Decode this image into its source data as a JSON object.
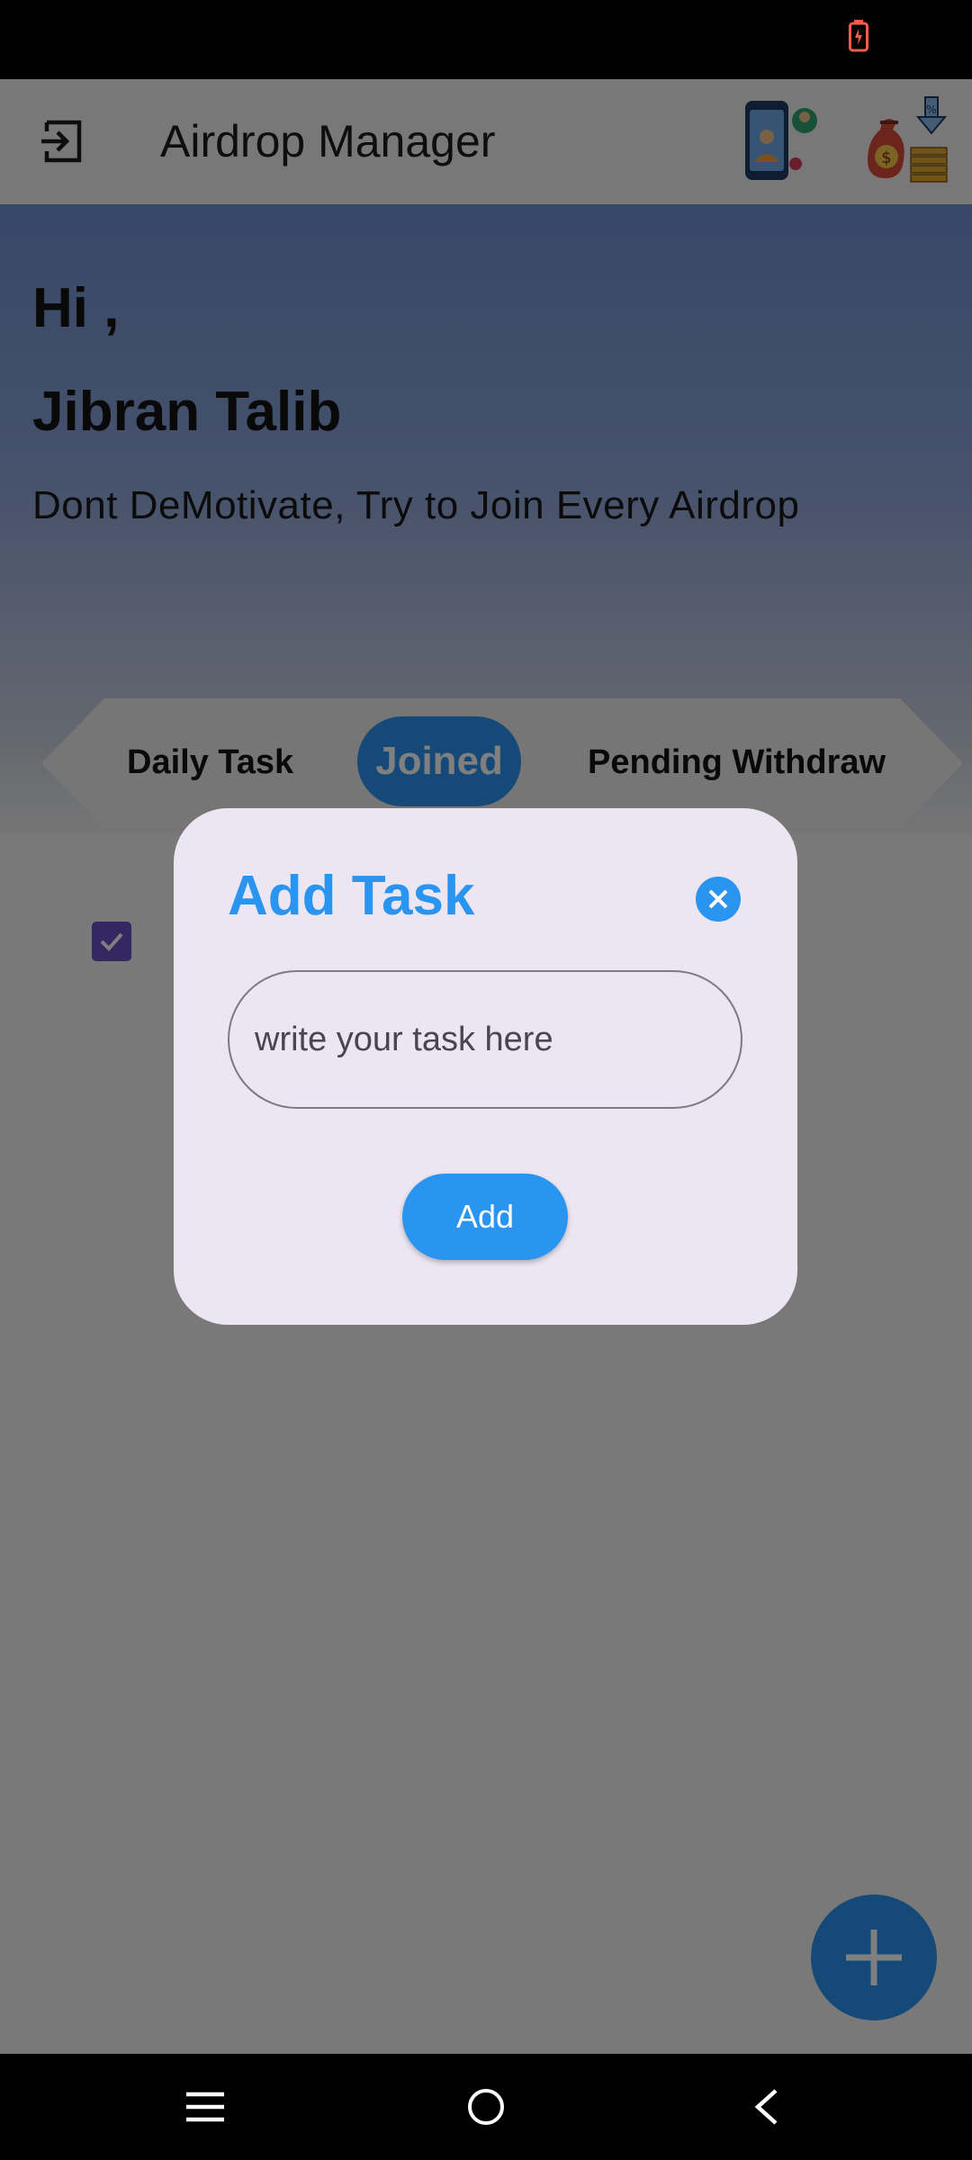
{
  "status_bar": {
    "battery": "battery-charging-icon"
  },
  "app_bar": {
    "title": "Airdrop Manager",
    "logout_icon": "logout-icon",
    "icons": [
      "phone-users-icon",
      "money-bag-icon"
    ]
  },
  "hero": {
    "greeting": "Hi ,",
    "user_name": "Jibran Talib",
    "motivation": "Dont DeMotivate, Try to Join Every Airdrop"
  },
  "tabs": {
    "items": [
      "Daily Task",
      "Joined",
      "Pending Withdraw"
    ],
    "selected": "Joined"
  },
  "dialog": {
    "title": "Add Task",
    "input_placeholder": "write your task here",
    "input_value": "",
    "add_label": "Add"
  },
  "colors": {
    "accent": "#2a95f0",
    "dialog_bg": "#ece6f2",
    "checkbox": "#6a4fc2"
  },
  "nav": {
    "items": [
      "menu-icon",
      "home-icon",
      "back-icon"
    ]
  }
}
